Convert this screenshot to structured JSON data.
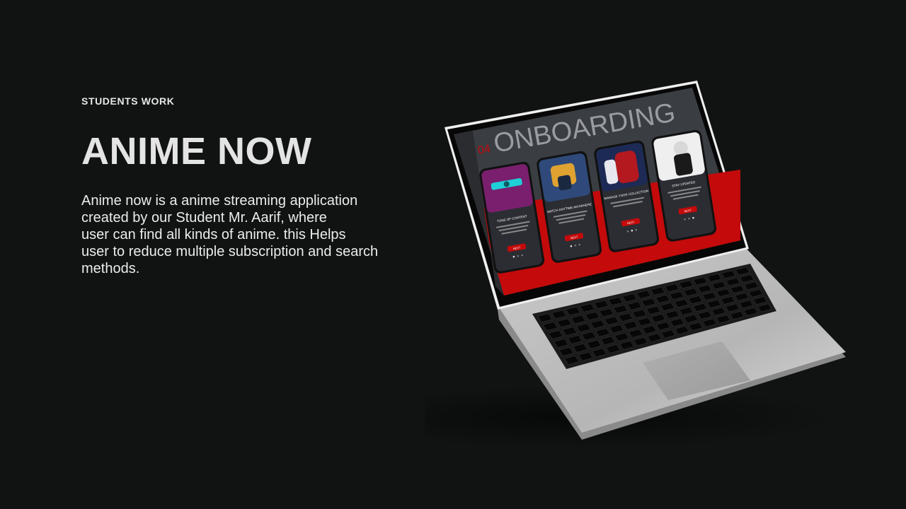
{
  "eyebrow": "STUDENTS WORK",
  "title": "ANIME NOW",
  "description_lines": [
    "Anime now is a anime streaming application",
    "created by our Student Mr. Aarif, where",
    "user can find all kinds of anime. this Helps",
    "user to reduce multiple subscription and search",
    "methods."
  ],
  "screen": {
    "step_number": "04",
    "heading": "ONBOARDING",
    "phones": [
      {
        "title": "TONS OF CONTENT",
        "button": "NEXT"
      },
      {
        "title": "WATCH ANYTIME ANYWHERE",
        "button": "NEXT"
      },
      {
        "title": "MANAGE YOUR COLLECTION",
        "button": "NEXT"
      },
      {
        "title": "STAY UPDATED",
        "button": "NEXT"
      }
    ]
  },
  "colors": {
    "background": "#111313",
    "accent_red": "#c40a0a",
    "screen_dark": "#3a3d42"
  }
}
